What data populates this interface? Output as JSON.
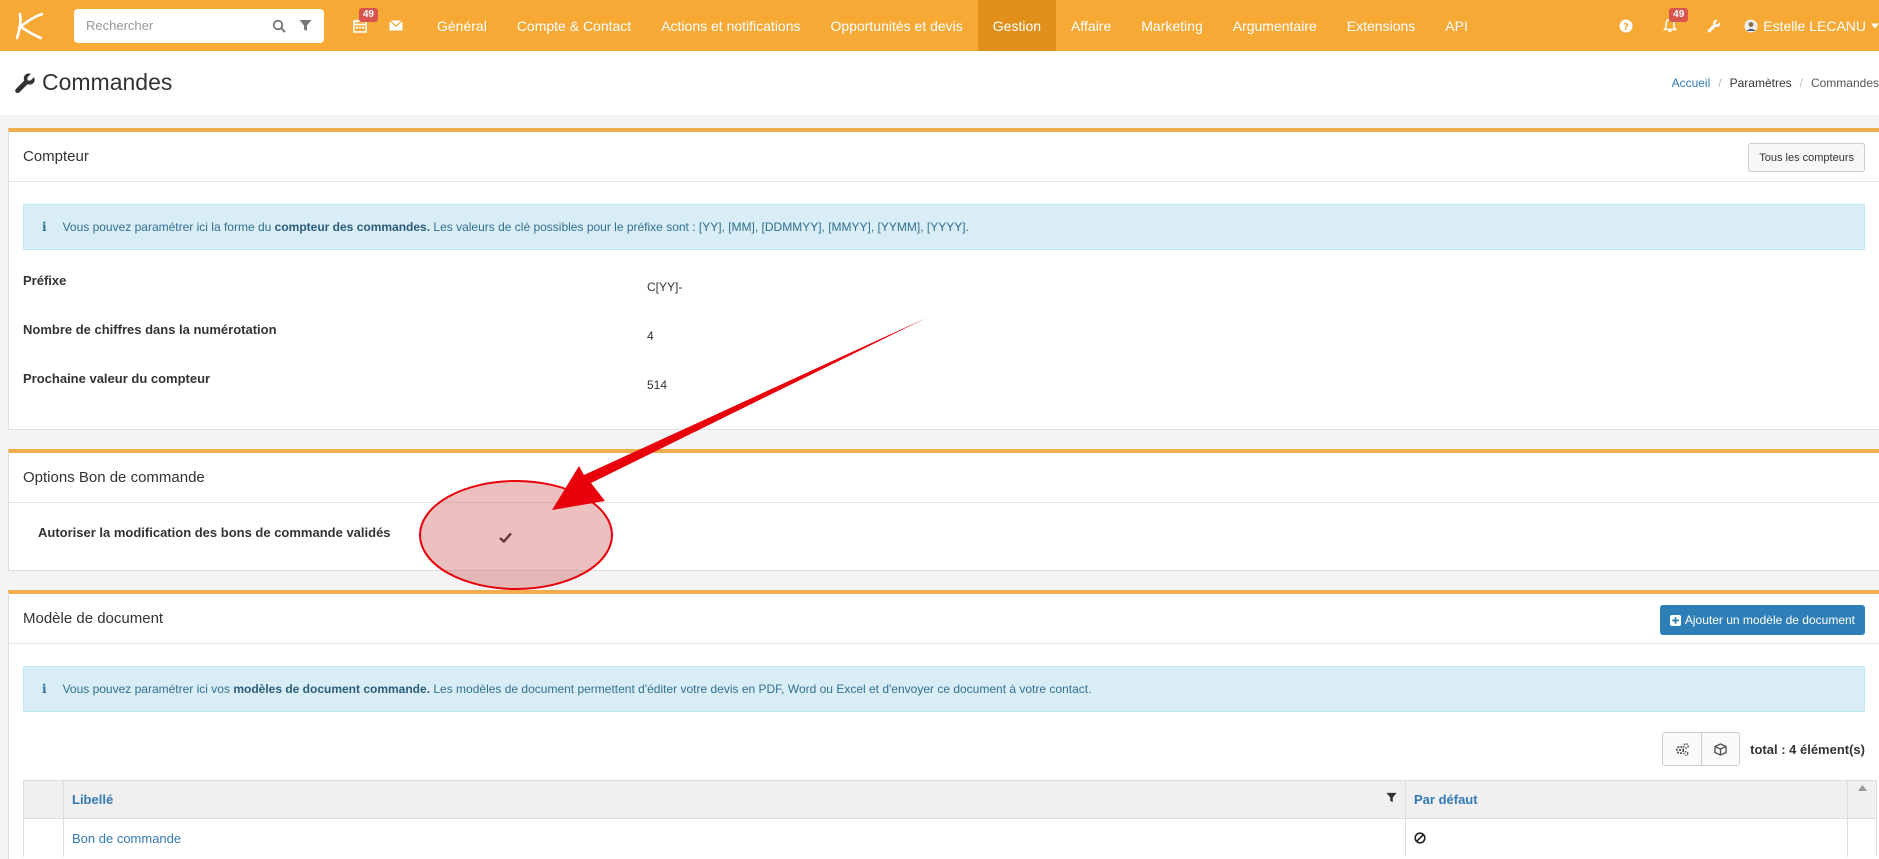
{
  "search": {
    "placeholder": "Rechercher"
  },
  "nav": {
    "calendar_badge": "49",
    "menu": [
      "Général",
      "Compte & Contact",
      "Actions et notifications",
      "Opportunités et devis",
      "Gestion",
      "Affaire",
      "Marketing",
      "Argumentaire",
      "Extensions",
      "API"
    ],
    "notif_badge": "49",
    "user_name": "Estelle LECANU"
  },
  "page": {
    "title": "Commandes",
    "breadcrumb": [
      "Accueil",
      "Paramètres",
      "Commandes"
    ]
  },
  "compteur": {
    "title": "Compteur",
    "button": "Tous les compteurs",
    "info_prefix": "Vous pouvez paramétrer ici la forme du ",
    "info_bold": "compteur des commandes.",
    "info_suffix": " Les valeurs de clé possibles pour le préfixe sont : [YY], [MM], [DDMMYY], [MMYY], [YYMM], [YYYY].",
    "rows": [
      {
        "label": "Préfixe",
        "value": "C[YY]-"
      },
      {
        "label": "Nombre de chiffres dans la numérotation",
        "value": "4"
      },
      {
        "label": "Prochaine valeur du compteur",
        "value": "514"
      }
    ]
  },
  "options": {
    "title": "Options Bon de commande",
    "row_label": "Autoriser la modification des bons de commande validés",
    "checked": true
  },
  "modele": {
    "title": "Modèle de document",
    "add_button": "Ajouter un modèle de document",
    "info_prefix": "Vous pouvez paramétrer ici vos ",
    "info_bold": "modèles de document commande.",
    "info_suffix": " Les modèles de document permettent d'éditer votre devis en PDF, Word ou Excel et d'envoyer ce document à votre contact.",
    "total": "total : 4 élément(s)",
    "columns": [
      "Libellé",
      "Par défaut"
    ],
    "rows": [
      {
        "libelle": "Bon de commande",
        "par_defaut": "no"
      }
    ]
  },
  "colors": {
    "accent": "#f7a936",
    "primary": "#2e7fb8",
    "annotation": "#e8000b"
  }
}
